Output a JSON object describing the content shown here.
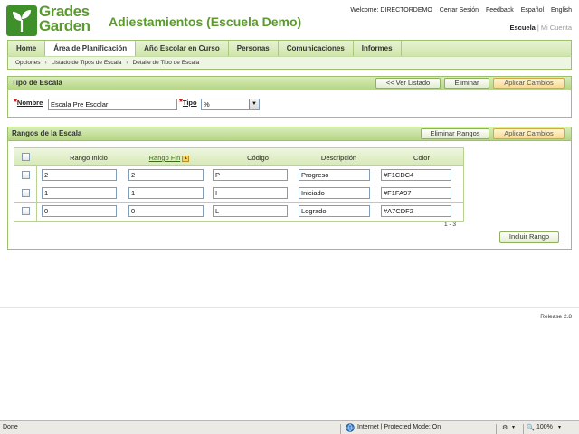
{
  "header": {
    "logo_text_1": "Grades",
    "logo_text_2": "Garden",
    "app_title": "Adiestamientos (Escuela Demo)",
    "welcome": "Welcome: DIRECTORDEMO",
    "logout": "Cerrar Sesión",
    "feedback": "Feedback",
    "lang_es": "Español",
    "lang_en": "English",
    "role_active": "Escuela",
    "role_sep": "|",
    "role_other": "Mi Cuenta"
  },
  "nav": {
    "items": [
      "Home",
      "Área de Planificación",
      "Año Escolar en Curso",
      "Personas",
      "Comunicaciones",
      "Informes"
    ]
  },
  "breadcrumb": [
    "Opciones",
    "Listado de Tipos de Escala",
    "Detalle de Tipo de Escala"
  ],
  "breadcrumb_sep": "›",
  "tipo_panel": {
    "title": "Tipo de Escala",
    "btn_list": "<< Ver Listado",
    "btn_delete": "Eliminar",
    "btn_apply": "Aplicar Cambios",
    "req_mark": "*",
    "nombre_label": "Nombre",
    "nombre_value": "Escala Pre Escolar",
    "tipo_label": "Tipo",
    "tipo_value": "%",
    "select_arrow": "▼"
  },
  "rangos_panel": {
    "title": "Rangos de la Escala",
    "btn_delete": "Eliminar Rangos",
    "btn_apply": "Aplicar Cambios",
    "btn_add": "Incluir Rango",
    "columns": [
      "Rango Inicio",
      "Rango Fin",
      "Código",
      "Descripción",
      "Color"
    ],
    "sort_glyph": "▲",
    "rows": [
      {
        "inicio": "2",
        "fin": "2",
        "codigo": "P",
        "descripcion": "Progreso",
        "color": "#F1CDC4"
      },
      {
        "inicio": "1",
        "fin": "1",
        "codigo": "I",
        "descripcion": "Iniciado",
        "color": "#F1FA97"
      },
      {
        "inicio": "0",
        "fin": "0",
        "codigo": "L",
        "descripcion": "Logrado",
        "color": "#A7CDF2"
      }
    ],
    "paging": "1 - 3"
  },
  "footer": {
    "release": "Release 2.8"
  },
  "statusbar": {
    "status": "Done",
    "zone": "Internet | Protected Mode: On",
    "zoom": "100%"
  },
  "colors": {
    "brand_green": "#5b9a2f",
    "required_red": "#cc0000",
    "apply_orange": "#f8d98e"
  }
}
